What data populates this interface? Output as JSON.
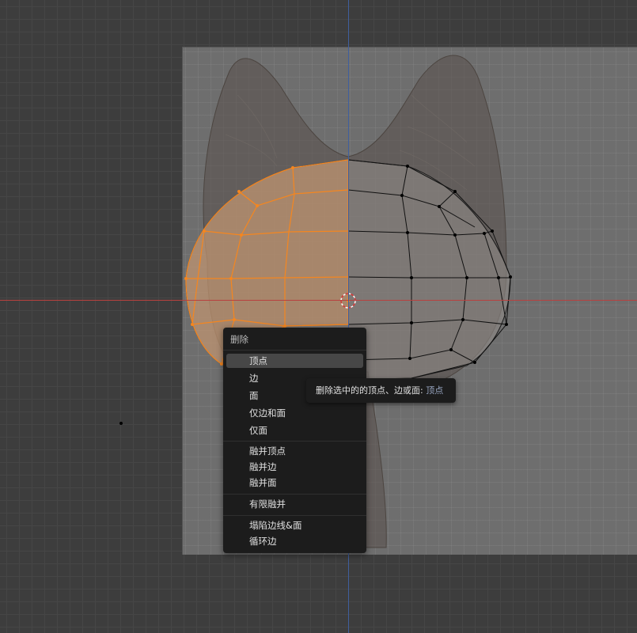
{
  "viewport": {
    "colors": {
      "grid_bg": "#3d3d3d",
      "x_axis": "#b8413f",
      "y_axis": "#3f5f9e",
      "selection": "#f5861f"
    }
  },
  "menu": {
    "title": "删除",
    "groups": [
      [
        {
          "label": "顶点",
          "highlighted": true
        },
        {
          "label": "边"
        },
        {
          "label": "面"
        },
        {
          "label": "仅边和面"
        },
        {
          "label": "仅面"
        }
      ],
      [
        {
          "label": "融并顶点"
        },
        {
          "label": "融并边"
        },
        {
          "label": "融并面"
        }
      ],
      [
        {
          "label": "有限融并"
        }
      ],
      [
        {
          "label": "塌陷边线&面"
        },
        {
          "label": "循环边"
        }
      ]
    ]
  },
  "tooltip": {
    "text": "删除选中的的顶点、边或面:",
    "value": "顶点"
  }
}
